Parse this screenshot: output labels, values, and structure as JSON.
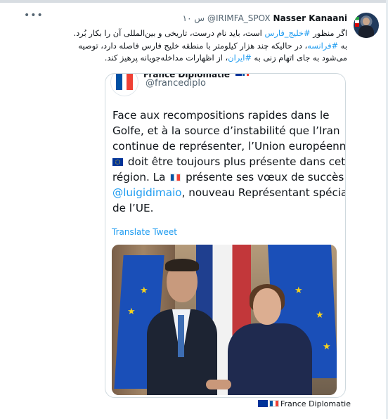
{
  "tweet": {
    "author_name": "Nasser Kanaani",
    "author_handle": "@IRIMFA_SPOX",
    "timestamp": "۱۰ س",
    "more_icon": "more-dots-icon",
    "text": {
      "line1_pre": "اگر منظور ",
      "line1_hashtag": "#خلیج_فارس",
      "line1_post": " است، باید نام درست، تاریخی و بین‌المللی آن را بکار بُرد.",
      "line2_pre": "به ",
      "line2_hashtag": "#فرانسه",
      "line2_post": "، در حالیکه چند هزار کیلومتر با منطقه خلیج فارس فاصله دارد، توصیه",
      "line3_pre": "می‌شود به جای اتهام زنی به ",
      "line3_hashtag": "#ایران",
      "line3_post": "، از اظهارات مداخله‌جویانه پرهیز کند."
    }
  },
  "quoted_tweet": {
    "name": "France Diplomatie",
    "handle": "@francediplo",
    "text": {
      "l1": "Face aux recompositions rapides dans le",
      "l2": "Golfe, et à la source d’instabilité que l’Iran",
      "l3": "continue de représenter, l’Union européenne",
      "l4": " doit être toujours plus présente dans cette",
      "l5a": "région. La ",
      "l5b": " présente ses vœux de succès à",
      "l6_mention": "@luigidimaio",
      "l6_post": ", nouveau Représentant spécial",
      "l7": "de l’UE."
    },
    "translate_label": "Translate Tweet",
    "photo_alt": "photo"
  },
  "source_label": "France Diplomatie",
  "colors": {
    "link": "#1d9bf0",
    "text": "#0f1419",
    "secondary": "#536471",
    "border": "#cfd9de"
  }
}
